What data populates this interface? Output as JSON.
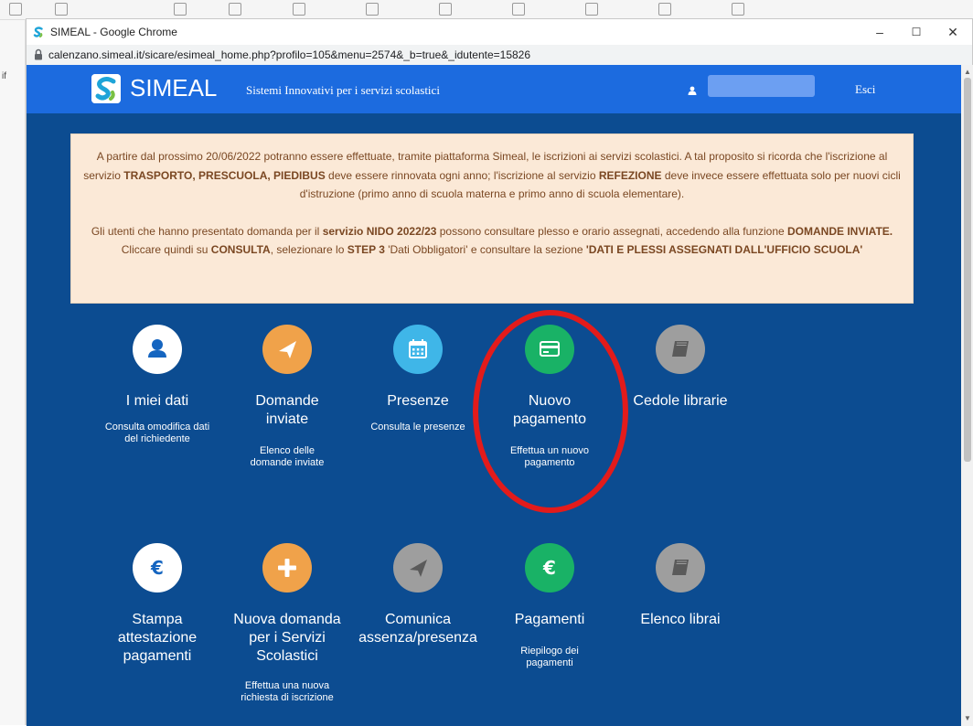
{
  "window": {
    "title": "SIMEAL - Google Chrome",
    "url": "calenzano.simeal.it/sicare/esimeal_home.php?profilo=105&menu=2574&_b=true&_idutente=15826",
    "controls": {
      "minimize": "–",
      "maximize": "☐",
      "close": "✕"
    }
  },
  "background_app": {
    "side_label": "if"
  },
  "header": {
    "logo": "SIMEAL",
    "tagline": "Sistemi Innovativi per i servizi scolastici",
    "logout": "Esci"
  },
  "notice": {
    "p1_a": "A partire dal prossimo 20/06/2022 potranno essere effettuate, tramite piattaforma Simeal, le iscrizioni ai servizi scolastici. A tal proposito si ricorda che l'iscrizione al servizio ",
    "p1_b": "TRASPORTO, PRESCUOLA, PIEDIBUS",
    "p1_c": " deve essere rinnovata ogni anno; l'iscrizione al servizio ",
    "p1_d": "REFEZIONE",
    "p1_e": " deve invece essere effettuata solo per nuovi cicli d'istruzione (primo anno di scuola materna e primo anno di scuola elementare).",
    "p2_a": "Gli utenti che hanno presentato domanda per il ",
    "p2_b": "servizio NIDO 2022/23",
    "p2_c": " possono consultare plesso e orario assegnati, accedendo alla funzione ",
    "p2_d": "DOMANDE INVIATE.",
    "p2_e": " Cliccare quindi su ",
    "p2_f": "CONSULTA",
    "p2_g": ", selezionare lo ",
    "p2_h": "STEP 3",
    "p2_i": " 'Dati Obbligatori' e consultare la sezione ",
    "p2_j": "'DATI E PLESSI ASSEGNATI DALL'UFFICIO SCUOLA'"
  },
  "tiles": [
    {
      "title": "I miei dati",
      "subtitle": "Consulta omodifica dati del richiedente",
      "icon": "user-icon",
      "color": "#ffffff",
      "glyph_color": "#1565c0"
    },
    {
      "title": "Domande inviate",
      "subtitle": "Elenco delle domande inviate",
      "icon": "paper-plane-icon",
      "color": "#f0a24a",
      "glyph_color": "#ffffff"
    },
    {
      "title": "Presenze",
      "subtitle": "Consulta le presenze",
      "icon": "calendar-icon",
      "color": "#3fb6e8",
      "glyph_color": "#ffffff"
    },
    {
      "title": "Nuovo pagamento",
      "subtitle": "Effettua un nuovo pagamento",
      "icon": "credit-card-icon",
      "color": "#19b266",
      "glyph_color": "#ffffff"
    },
    {
      "title": "Cedole librarie",
      "subtitle": "",
      "icon": "book-icon",
      "color": "#9e9e9e",
      "glyph_color": "#555555"
    },
    {
      "title": "Stampa attestazione pagamenti",
      "subtitle": "",
      "icon": "euro-icon",
      "color": "#ffffff",
      "glyph_color": "#1565c0"
    },
    {
      "title": "Nuova domanda per i Servizi Scolastici",
      "subtitle": "Effettua una nuova richiesta di iscrizione",
      "icon": "plus-icon",
      "color": "#f0a24a",
      "glyph_color": "#ffffff"
    },
    {
      "title": "Comunica assenza/presenza",
      "subtitle": "",
      "icon": "paper-plane-icon",
      "color": "#9e9e9e",
      "glyph_color": "#555555"
    },
    {
      "title": "Pagamenti",
      "subtitle": "Riepilogo dei pagamenti",
      "icon": "euro-icon",
      "color": "#19b266",
      "glyph_color": "#ffffff"
    },
    {
      "title": "Elenco librai",
      "subtitle": "",
      "icon": "book-icon",
      "color": "#9e9e9e",
      "glyph_color": "#555555"
    }
  ],
  "colors": {
    "page_bg": "#0c4c91",
    "header_bg": "#1c6bdf",
    "notice_bg": "#fbe9d7",
    "notice_text": "#7a4722",
    "highlight": "#e31b1b"
  }
}
